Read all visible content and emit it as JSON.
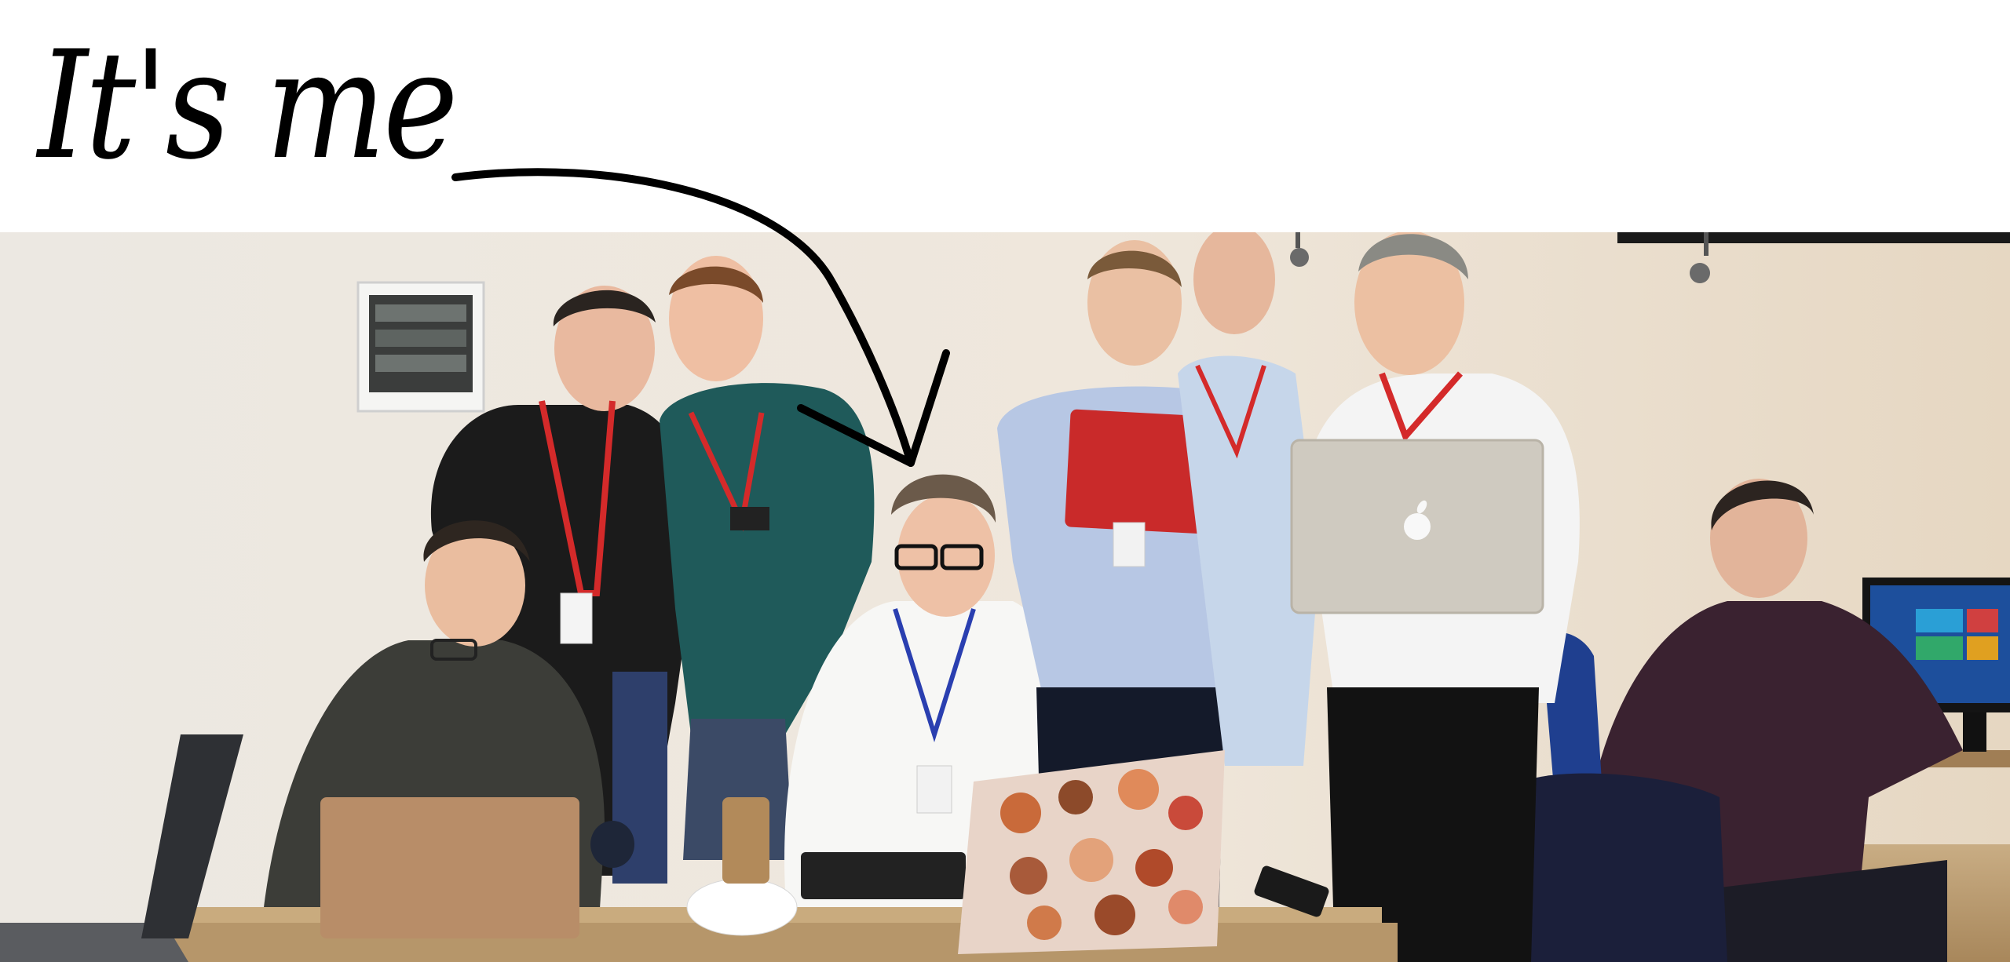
{
  "caption": "It's me",
  "colors": {
    "background": "#ffffff",
    "ink": "#000000",
    "wall": "#ece6dd",
    "lanyard": "#d42a2a",
    "floor": "#b89a70"
  },
  "icons": [
    "hand-drawn-arrow",
    "apple-logo"
  ]
}
